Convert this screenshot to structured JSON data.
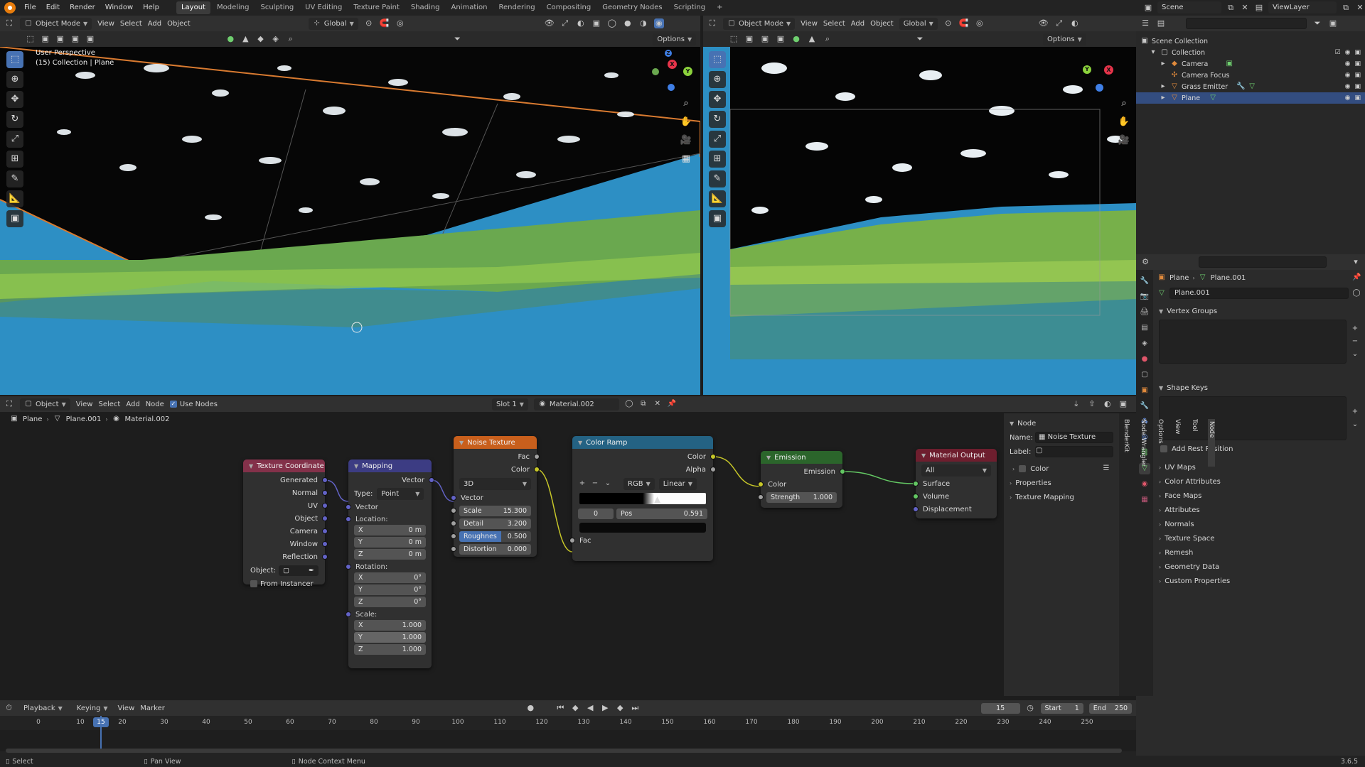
{
  "topbar": {
    "menus": [
      "File",
      "Edit",
      "Render",
      "Window",
      "Help"
    ],
    "workspaces": [
      "Layout",
      "Modeling",
      "Sculpting",
      "UV Editing",
      "Texture Paint",
      "Shading",
      "Animation",
      "Rendering",
      "Compositing",
      "Geometry Nodes",
      "Scripting"
    ],
    "add_tab": "+",
    "scene": "Scene",
    "view_layer": "ViewLayer"
  },
  "viewport_left": {
    "mode": "Object Mode",
    "menus": [
      "View",
      "Select",
      "Add",
      "Object"
    ],
    "orientation": "Global",
    "options": "Options",
    "overlay_title": "User Perspective",
    "overlay_sub": "(15) Collection | Plane"
  },
  "viewport_right": {
    "mode": "Object Mode",
    "menus": [
      "View",
      "Select",
      "Add",
      "Object"
    ],
    "orientation": "Global",
    "options": "Options"
  },
  "gizmo": {
    "x": "X",
    "y": "Y",
    "z": "Z"
  },
  "outliner": {
    "root": "Scene Collection",
    "collection": "Collection",
    "items": [
      "Camera",
      "Camera Focus",
      "Grass Emitter",
      "Plane"
    ],
    "selected": "Plane"
  },
  "properties": {
    "breadcrumb_obj": "Plane",
    "breadcrumb_mesh": "Plane.001",
    "mesh_name": "Plane.001",
    "panels": [
      "Vertex Groups",
      "Shape Keys",
      "UV Maps",
      "Color Attributes",
      "Face Maps",
      "Attributes",
      "Normals",
      "Texture Space",
      "Remesh",
      "Geometry Data",
      "Custom Properties"
    ],
    "add_rest_position": "Add Rest Position"
  },
  "node_header": {
    "object_dd": "Object",
    "menus": [
      "View",
      "Select",
      "Add",
      "Node"
    ],
    "use_nodes": "Use Nodes",
    "slot": "Slot 1",
    "material": "Material.002"
  },
  "node_breadcrumb": {
    "obj": "Plane",
    "mesh": "Plane.001",
    "mat": "Material.002"
  },
  "nodes": {
    "texcoord": {
      "title": "Texture Coordinate",
      "outputs": [
        "Generated",
        "Normal",
        "UV",
        "Object",
        "Camera",
        "Window",
        "Reflection"
      ],
      "object_label": "Object:",
      "from_instancer": "From Instancer"
    },
    "mapping": {
      "title": "Mapping",
      "out": "Vector",
      "type_label": "Type:",
      "type_value": "Point",
      "vector_in": "Vector",
      "location": "Location:",
      "loc": [
        [
          "X",
          "0 m"
        ],
        [
          "Y",
          "0 m"
        ],
        [
          "Z",
          "0 m"
        ]
      ],
      "rotation": "Rotation:",
      "rot": [
        [
          "X",
          "0°"
        ],
        [
          "Y",
          "0°"
        ],
        [
          "Z",
          "0°"
        ]
      ],
      "scale": "Scale:",
      "scl": [
        [
          "X",
          "1.000"
        ],
        [
          "Y",
          "1.000"
        ],
        [
          "Z",
          "1.000"
        ]
      ]
    },
    "noise": {
      "title": "Noise Texture",
      "fac": "Fac",
      "color": "Color",
      "dim": "3D",
      "vector": "Vector",
      "fields": [
        [
          "Scale",
          "15.300"
        ],
        [
          "Detail",
          "3.200"
        ],
        [
          "Roughness",
          "0.500"
        ],
        [
          "Distortion",
          "0.000"
        ]
      ],
      "roughness_short": "Roughnes"
    },
    "ramp": {
      "title": "Color Ramp",
      "color": "Color",
      "alpha": "Alpha",
      "mode": "RGB",
      "interp": "Linear",
      "index": "0",
      "pos_label": "Pos",
      "pos_value": "0.591",
      "fac": "Fac"
    },
    "emission": {
      "title": "Emission",
      "out": "Emission",
      "color": "Color",
      "strength_label": "Strength",
      "strength_value": "1.000"
    },
    "output": {
      "title": "Material Output",
      "target": "All",
      "inputs": [
        "Surface",
        "Volume",
        "Displacement"
      ]
    }
  },
  "node_sidebar": {
    "header": "Node",
    "name_label": "Name:",
    "name_value": "Noise Texture",
    "label_label": "Label:",
    "color": "Color",
    "properties": "Properties",
    "texture_mapping": "Texture Mapping",
    "tabs": [
      "Node",
      "Tool",
      "View",
      "Options",
      "Node Wrangler",
      "BlenderKit"
    ]
  },
  "timeline": {
    "menus": [
      "Playback",
      "Keying",
      "View",
      "Marker"
    ],
    "current_frame": "15",
    "start_label": "Start",
    "start": "1",
    "end_label": "End",
    "end": "250",
    "ticks": [
      "0",
      "10",
      "20",
      "30",
      "40",
      "50",
      "60",
      "70",
      "80",
      "90",
      "100",
      "110",
      "120",
      "130",
      "140",
      "150",
      "160",
      "170",
      "180",
      "190",
      "200",
      "210",
      "220",
      "230",
      "240",
      "250"
    ]
  },
  "statusbar": {
    "items": [
      "Select",
      "Pan View",
      "Node Context Menu"
    ],
    "version": "3.6.5"
  },
  "colors": {
    "accent": "#4772b3",
    "sky": "#2d8fc4",
    "node_input_header": "#83314a",
    "node_vector_header": "#3c3c83",
    "node_texture_header": "#e06c1b",
    "node_converter_header": "#246283",
    "node_shader_header": "#2b652b",
    "node_output_header": "#6e1e2e"
  }
}
